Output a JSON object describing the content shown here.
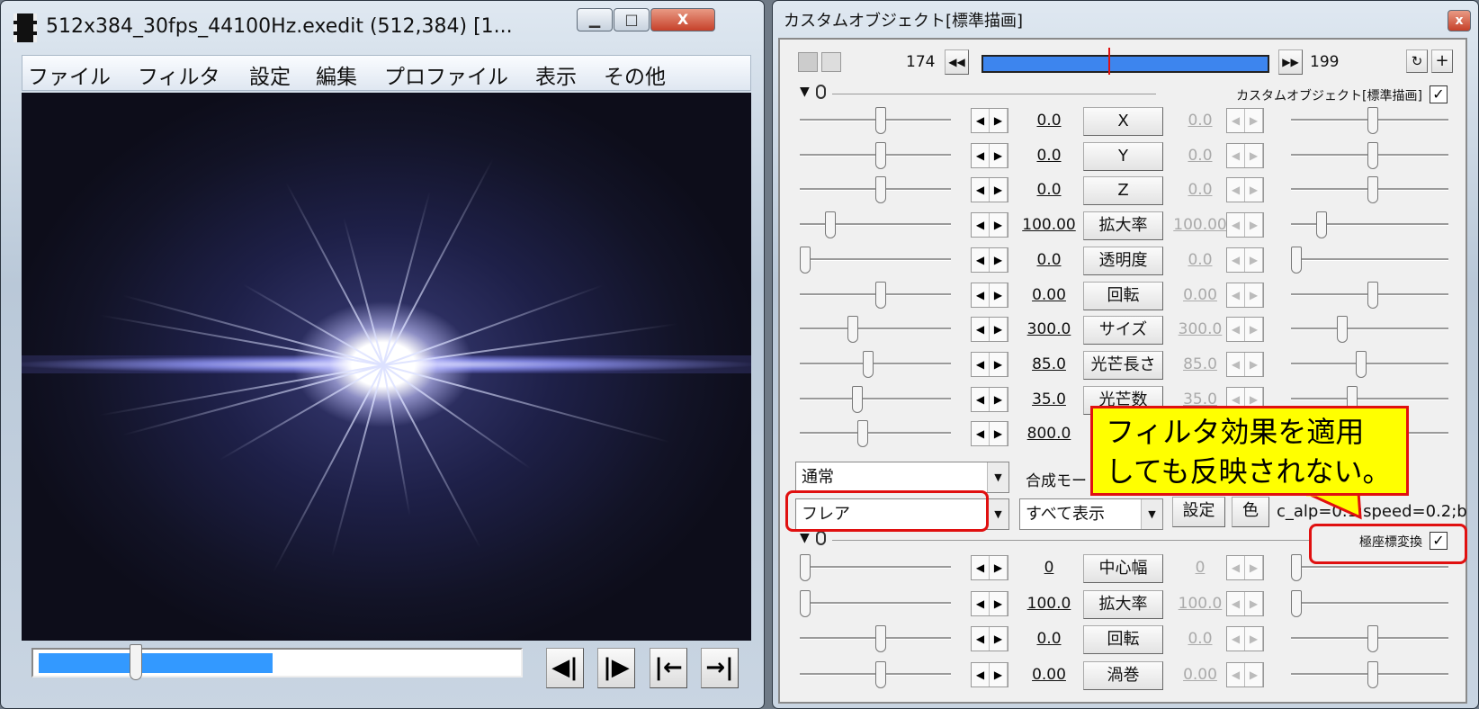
{
  "main_window": {
    "title": "512x384_30fps_44100Hz.exedit (512,384)  [1...",
    "caption_buttons": {
      "minimize": "▁",
      "maximize": "□",
      "close": "X"
    },
    "menu": [
      "ファイル",
      "フィルタ",
      "設定",
      "編集",
      "プロファイル",
      "表示",
      "その他"
    ],
    "seek_position": 0.21,
    "seek_fill": 0.48,
    "playback_buttons": [
      "◀|",
      "|▶",
      "|←",
      "→|"
    ]
  },
  "panel": {
    "title": "カスタムオブジェクト[標準描画]",
    "close": "x",
    "timeline": {
      "start": "174",
      "end": "199",
      "prev": "◀◀",
      "next": "▶▶",
      "cursor": 0.44,
      "sync_icon": "↻",
      "add_icon": "+"
    },
    "section1": {
      "label": "カスタムオブジェクト[標準描画]",
      "checked": "✓"
    },
    "params": [
      {
        "name": "X",
        "value": "0.0",
        "end": "0.0",
        "l": 0.54,
        "r": 0.52
      },
      {
        "name": "Y",
        "value": "0.0",
        "end": "0.0",
        "l": 0.54,
        "r": 0.52
      },
      {
        "name": "Z",
        "value": "0.0",
        "end": "0.0",
        "l": 0.54,
        "r": 0.52
      },
      {
        "name": "拡大率",
        "value": "100.00",
        "end": "100.00",
        "l": 0.18,
        "r": 0.17
      },
      {
        "name": "透明度",
        "value": "0.0",
        "end": "0.0",
        "l": 0.0,
        "r": 0.0
      },
      {
        "name": "回転",
        "value": "0.00",
        "end": "0.00",
        "l": 0.54,
        "r": 0.52
      },
      {
        "name": "サイズ",
        "value": "300.0",
        "end": "300.0",
        "l": 0.34,
        "r": 0.31
      },
      {
        "name": "光芒長さ",
        "value": "85.0",
        "end": "85.0",
        "l": 0.45,
        "r": 0.44
      },
      {
        "name": "光芒数",
        "value": "35.0",
        "end": "35.0",
        "l": 0.37,
        "r": 0.38
      },
      {
        "name": "",
        "value": "800.0",
        "end": "",
        "l": 0.41,
        "r": 0.4
      }
    ],
    "blend": {
      "value": "通常",
      "label": "合成モード"
    },
    "filter": {
      "value": "フレア",
      "view": "すべて表示",
      "settings": "設定",
      "color": "色",
      "params": "c_alp=0.1;speed=0.2;b"
    },
    "section2": {
      "label": "極座標変換",
      "checked": "✓"
    },
    "params2": [
      {
        "name": "中心幅",
        "value": "0",
        "end": "0",
        "l": 0.0,
        "r": 0.0
      },
      {
        "name": "拡大率",
        "value": "100.0",
        "end": "100.0",
        "l": 0.0,
        "r": 0.0
      },
      {
        "name": "回転",
        "value": "0.0",
        "end": "0.0",
        "l": 0.54,
        "r": 0.52
      },
      {
        "name": "渦巻",
        "value": "0.00",
        "end": "0.00",
        "l": 0.54,
        "r": 0.52
      }
    ]
  },
  "callout": {
    "line1": "フィルタ効果を適用",
    "line2": "しても反映されない。"
  }
}
